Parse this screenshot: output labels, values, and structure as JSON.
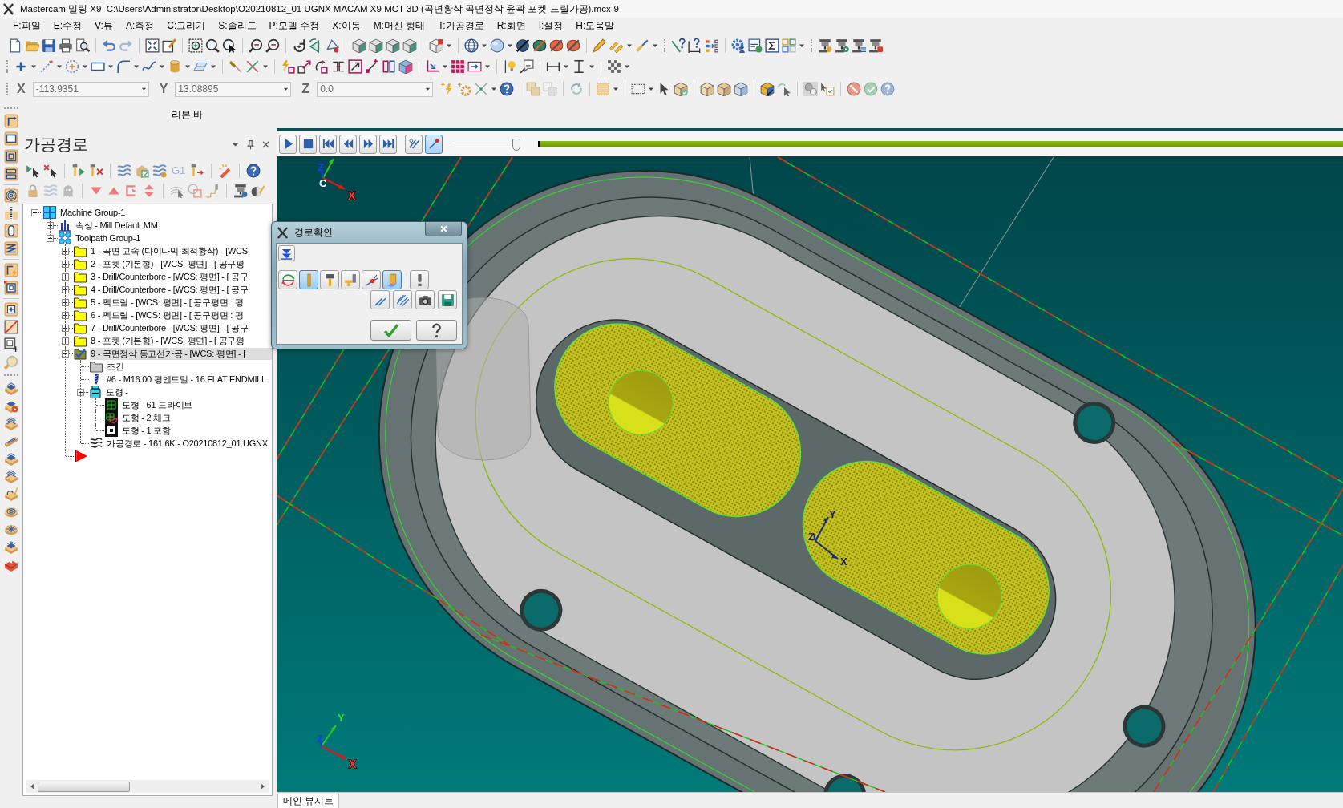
{
  "window": {
    "title": "Mastercam 밀링 X9  C:\\Users\\Administrator\\Desktop\\O20210812_01 UGNX MACAM X9 MCT 3D (곡면황삭 곡면정삭 윤곽 포켓 드릴가공).mcx-9"
  },
  "menu": [
    "F:파일",
    "E:수정",
    "V:뷰",
    "A:측정",
    "C:그리기",
    "S:솔리드",
    "P:모델 수정",
    "X:이동",
    "M:머신 형태",
    "T:가공경로",
    "R:화면",
    "I:설정",
    "H:도움말"
  ],
  "coordinates": [
    {
      "axis": "X",
      "value": "-113.9351"
    },
    {
      "axis": "Y",
      "value": "13.08895"
    },
    {
      "axis": "Z",
      "value": "0.0"
    }
  ],
  "ribbon_bar": {
    "label": "리본 바"
  },
  "toolpaths_panel": {
    "title": "가공경로",
    "toolbar_text_button": "G1",
    "tree": [
      {
        "kind": "machine",
        "label": "Machine Group-1",
        "expanded": true,
        "selected": false,
        "children": [
          {
            "kind": "properties",
            "label": "속성 - Mill Default MM",
            "expanded": false,
            "selected": false
          },
          {
            "kind": "group",
            "label": "Toolpath Group-1",
            "expanded": true,
            "selected": false,
            "children": [
              {
                "kind": "operation",
                "label": "1 - 곡면 고속 (다이나믹 최적황삭) - [WCS:",
                "expanded": false,
                "selected": false
              },
              {
                "kind": "operation",
                "label": "2 - 포켓 (기본형) - [WCS: 평면] - [ 공구평",
                "expanded": false,
                "selected": false
              },
              {
                "kind": "operation",
                "label": "3 - Drill/Counterbore - [WCS: 평면] - [ 공구",
                "expanded": false,
                "selected": false
              },
              {
                "kind": "operation",
                "label": "4 - Drill/Counterbore - [WCS: 평면] - [ 공구",
                "expanded": false,
                "selected": false
              },
              {
                "kind": "operation",
                "label": "5 - 펙드릴 - [WCS: 평면] - [ 공구평면 : 평",
                "expanded": false,
                "selected": false
              },
              {
                "kind": "operation",
                "label": "6 - 펙드릴 - [WCS: 평면] - [ 공구평면 : 평",
                "expanded": false,
                "selected": false
              },
              {
                "kind": "operation",
                "label": "7 - Drill/Counterbore - [WCS: 평면] - [ 공구",
                "expanded": false,
                "selected": false
              },
              {
                "kind": "operation",
                "label": "8 - 포켓 (기본형) - [WCS: 평면] - [ 공구평",
                "expanded": false,
                "selected": false
              },
              {
                "kind": "operation",
                "label": "9 - 곡면정삭 등고선가공 - [WCS: 평면] - [",
                "expanded": true,
                "selected": true,
                "children": [
                  {
                    "kind": "parameters",
                    "label": "조건",
                    "selected": false
                  },
                  {
                    "kind": "tool",
                    "label": "#6 - M16.00 평엔드밀 - 16 FLAT ENDMILL",
                    "selected": false
                  },
                  {
                    "kind": "geometry",
                    "label": "도형 -",
                    "expanded": true,
                    "selected": false,
                    "children": [
                      {
                        "kind": "drive",
                        "label": "도형 - 61 드라이브",
                        "selected": false
                      },
                      {
                        "kind": "checkgeo",
                        "label": "도형 - 2 체크",
                        "selected": false
                      },
                      {
                        "kind": "containment",
                        "label": "도형 - 1 포함",
                        "selected": false
                      }
                    ]
                  },
                  {
                    "kind": "toolpath",
                    "label": "가공경로 - 161.6K - O20210812_01 UGNX",
                    "selected": false
                  }
                ]
              },
              {
                "kind": "marker"
              }
            ]
          }
        ]
      }
    ]
  },
  "playback": {
    "display_toggles": [
      {
        "selected": false
      },
      {
        "selected": true
      }
    ],
    "slider": {
      "level": 0.95
    },
    "progress": {
      "level": 1
    }
  },
  "viewport": {
    "triads": [
      {
        "kind": "view",
        "labels": [
          {
            "kind": "z",
            "text": "Z"
          },
          {
            "kind": "c",
            "text": "C"
          },
          {
            "kind": "x",
            "text": "X"
          }
        ]
      },
      {
        "kind": "view",
        "labels": [
          {
            "kind": "y",
            "text": "Y"
          },
          {
            "kind": "z",
            "text": "Z"
          },
          {
            "kind": "x",
            "text": "X"
          }
        ]
      },
      {
        "kind": "wcs",
        "labels": [
          {
            "kind": "y",
            "text": "Y"
          },
          {
            "kind": "z",
            "text": "Z"
          },
          {
            "kind": "x",
            "text": "X"
          }
        ]
      }
    ]
  },
  "dialog": {
    "title": "경로확인",
    "options": [
      {
        "selected": false
      },
      {
        "selected": true
      },
      {
        "selected": false
      },
      {
        "selected": false
      },
      {
        "selected": false
      },
      {
        "selected": true
      },
      {
        "selected": false
      }
    ]
  },
  "view_sheets": [
    {
      "label": "메인 뷰시트",
      "selected": true
    }
  ]
}
